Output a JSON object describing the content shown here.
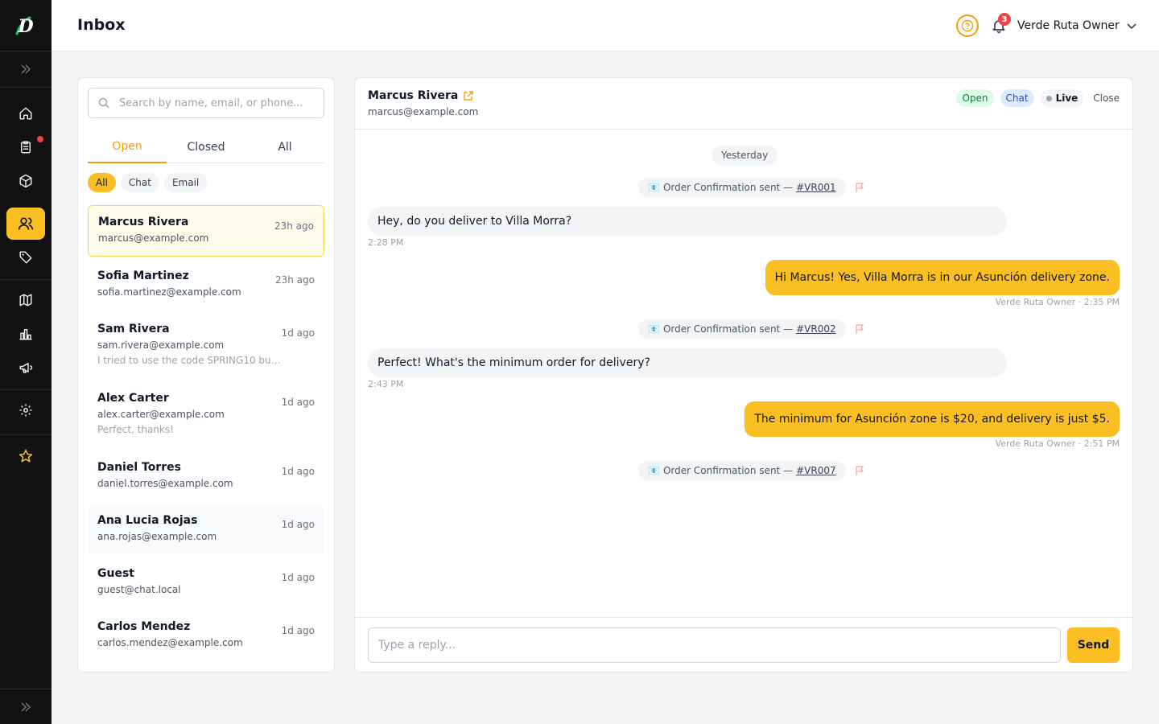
{
  "app": {
    "logo_letter": "D"
  },
  "header": {
    "title": "Inbox",
    "notification_count": "3",
    "user_name": "Verde Ruta Owner"
  },
  "sidebar": {
    "items": [
      {
        "icon": "home-icon"
      },
      {
        "icon": "orders-icon",
        "has_dot": true
      },
      {
        "icon": "box-icon"
      },
      {
        "icon": "users-icon",
        "active": true
      },
      {
        "icon": "tag-icon"
      },
      {
        "icon": "map-icon"
      },
      {
        "icon": "chart-icon"
      },
      {
        "icon": "megaphone-icon"
      },
      {
        "icon": "gear-icon"
      },
      {
        "icon": "star-icon"
      }
    ]
  },
  "list": {
    "search_placeholder": "Search by name, email, or phone...",
    "tabs": [
      "Open",
      "Closed",
      "All"
    ],
    "active_tab": "Open",
    "filters": [
      "All",
      "Chat",
      "Email"
    ],
    "active_filter": "All",
    "conversations": [
      {
        "name": "Marcus Rivera",
        "email": "marcus@example.com",
        "time": "23h ago",
        "preview": ""
      },
      {
        "name": "Sofia Martinez",
        "email": "sofia.martinez@example.com",
        "time": "23h ago",
        "preview": ""
      },
      {
        "name": "Sam Rivera",
        "email": "sam.rivera@example.com",
        "time": "1d ago",
        "preview": "I tried to use the code SPRING10 but i..."
      },
      {
        "name": "Alex Carter",
        "email": "alex.carter@example.com",
        "time": "1d ago",
        "preview": "Perfect, thanks!"
      },
      {
        "name": "Daniel Torres",
        "email": "daniel.torres@example.com",
        "time": "1d ago",
        "preview": ""
      },
      {
        "name": "Ana Lucia Rojas",
        "email": "ana.rojas@example.com",
        "time": "1d ago",
        "preview": ""
      },
      {
        "name": "Guest",
        "email": "guest@chat.local",
        "time": "1d ago",
        "preview": ""
      },
      {
        "name": "Carlos Mendez",
        "email": "carlos.mendez@example.com",
        "time": "1d ago",
        "preview": ""
      }
    ]
  },
  "chat": {
    "name": "Marcus Rivera",
    "email": "marcus@example.com",
    "badges": {
      "status": "Open",
      "channel": "Chat",
      "live": "Live"
    },
    "close_label": "Close",
    "date_label": "Yesterday",
    "system_text": "Order Confirmation sent —",
    "system_emoji": "📧",
    "orders": [
      "#VR001",
      "#VR002",
      "#VR007"
    ],
    "messages": [
      {
        "text": "Hey, do you deliver to Villa Morra?",
        "meta": "2:28 PM"
      },
      {
        "text": "Hi Marcus! Yes, Villa Morra is in our Asunción delivery zone.",
        "meta": "Verde Ruta Owner · 2:35 PM"
      },
      {
        "text": "Perfect! What's the minimum order for delivery?",
        "meta": "2:43 PM"
      },
      {
        "text": "The minimum for Asunción zone is $20, and delivery is just $5.",
        "meta": "Verde Ruta Owner · 2:51 PM"
      }
    ],
    "reply_placeholder": "Type a reply...",
    "send_label": "Send"
  },
  "colors": {
    "accent": "#fbbf24",
    "sidebar_bg": "#111111",
    "logo_green": "#22c55e",
    "badge_red": "#ef4444"
  }
}
